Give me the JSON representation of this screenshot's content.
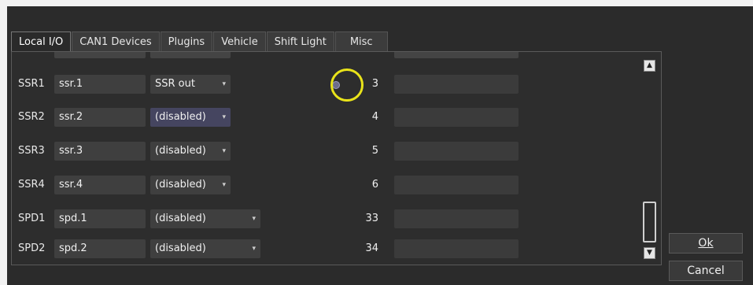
{
  "tabs": [
    {
      "label": "Local I/O",
      "active": true
    },
    {
      "label": "CAN1 Devices"
    },
    {
      "label": "Plugins"
    },
    {
      "label": "Vehicle"
    },
    {
      "label": "Shift Light"
    },
    {
      "label": "Misc"
    }
  ],
  "rows": [
    {
      "label": "SSR1",
      "name": "ssr.1",
      "mode": "SSR out",
      "number": "3",
      "radio": true
    },
    {
      "label": "SSR2",
      "name": "ssr.2",
      "mode": "(disabled)",
      "number": "4"
    },
    {
      "label": "SSR3",
      "name": "ssr.3",
      "mode": "(disabled)",
      "number": "5"
    },
    {
      "label": "SSR4",
      "name": "ssr.4",
      "mode": "(disabled)",
      "number": "6"
    },
    {
      "label": "SPD1",
      "name": "spd.1",
      "mode": "(disabled)",
      "number": "33"
    },
    {
      "label": "SPD2",
      "name": "spd.2",
      "mode": "(disabled)",
      "number": "34"
    }
  ],
  "dropdown_arrow": "▾",
  "scrollbar": {
    "up_icon": "▲",
    "down_icon": "▼"
  },
  "buttons": {
    "ok_label": "Ok",
    "cancel_label": "Cancel"
  },
  "colors": {
    "highlight_ring": "#e9e31a",
    "background": "#2b2b2b"
  }
}
